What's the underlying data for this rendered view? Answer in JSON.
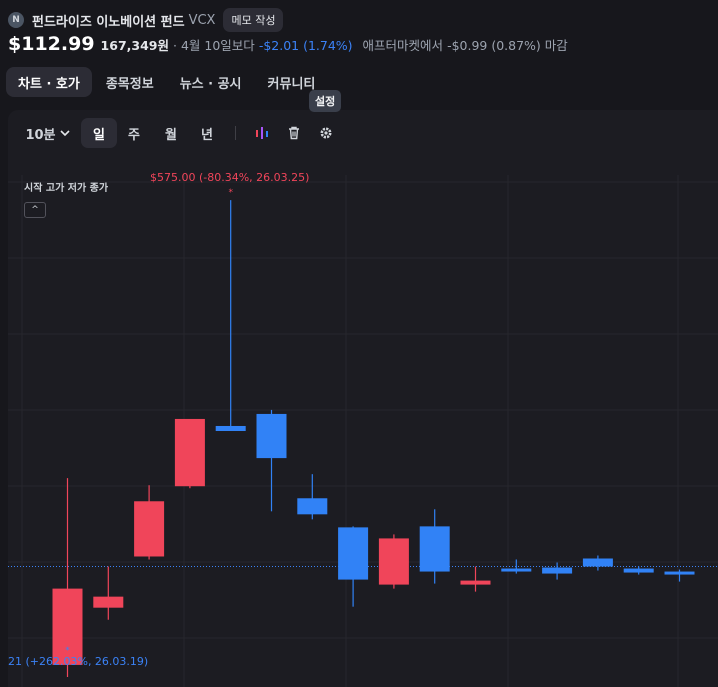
{
  "header": {
    "logo_letter": "N",
    "fund_name": "펀드라이즈 이노베이션 펀드",
    "ticker": "VCX",
    "memo_button": "메모 작성",
    "price": "$112.99",
    "volume": "167,349원",
    "separator": "·",
    "date_label": "4월 10일보다",
    "change": "-$2.01 (1.74%)",
    "after_market_label": "애프터마켓에서",
    "after_market_change": "-$0.99 (0.87%) 마감"
  },
  "tabs": [
    {
      "label": "차트 · 호가",
      "active": true
    },
    {
      "label": "종목정보",
      "active": false
    },
    {
      "label": "뉴스 · 공시",
      "active": false
    },
    {
      "label": "커뮤니티",
      "active": false
    }
  ],
  "tooltip": "설정",
  "toolbar": {
    "interval": "10분",
    "periods": [
      "일",
      "주",
      "월",
      "년"
    ],
    "active_period": "일",
    "icons": [
      "indicator-icon",
      "trash-icon",
      "gear-icon"
    ]
  },
  "legend_label": "시작 고가 저가 종가",
  "collapse_symbol": "^",
  "colors": {
    "up": "#f0455a",
    "down": "#3182f6",
    "last_price_line": "#3b82f6",
    "background": "#17171c"
  },
  "chart_data": {
    "type": "candlestick",
    "y_scale_hint": "linear",
    "candles": [
      {
        "open": 112,
        "high": 298,
        "low": 100,
        "close": 188,
        "dir": "up"
      },
      {
        "open": 169,
        "high": 210,
        "low": 157,
        "close": 180,
        "dir": "up"
      },
      {
        "open": 220,
        "high": 291,
        "low": 217,
        "close": 275,
        "dir": "up"
      },
      {
        "open": 290,
        "high": 352,
        "low": 288,
        "close": 357,
        "dir": "up"
      },
      {
        "open": 345,
        "high": 575,
        "low": 348,
        "close": 350,
        "dir": "down"
      },
      {
        "open": 362,
        "high": 366,
        "low": 265,
        "close": 318,
        "dir": "down"
      },
      {
        "open": 278,
        "high": 302,
        "low": 257,
        "close": 262,
        "dir": "down"
      },
      {
        "open": 249,
        "high": 250,
        "low": 170,
        "close": 197,
        "dir": "down"
      },
      {
        "open": 192,
        "high": 242,
        "low": 188,
        "close": 238,
        "dir": "up"
      },
      {
        "open": 250,
        "high": 267,
        "low": 193,
        "close": 205,
        "dir": "down"
      },
      {
        "open": 196,
        "high": 210,
        "low": 185,
        "close": 192,
        "dir": "up"
      },
      {
        "open": 208,
        "high": 217,
        "low": 203,
        "close": 207,
        "dir": "down"
      },
      {
        "open": 209,
        "high": 214,
        "low": 197,
        "close": 203,
        "dir": "down"
      },
      {
        "open": 218,
        "high": 221,
        "low": 206,
        "close": 210,
        "dir": "down"
      },
      {
        "open": 208,
        "high": 210,
        "low": 202,
        "close": 204,
        "dir": "down"
      },
      {
        "open": 205,
        "high": 207,
        "low": 195,
        "close": 202,
        "dir": "down"
      }
    ],
    "max_annotation": {
      "candle_index": 4,
      "label": "$575.00 (-80.34%, 26.03.25)"
    },
    "min_annotation": {
      "candle_index": 0,
      "label": "21 (+262.03%, 26.03.19)"
    },
    "last_price": 112.99
  }
}
